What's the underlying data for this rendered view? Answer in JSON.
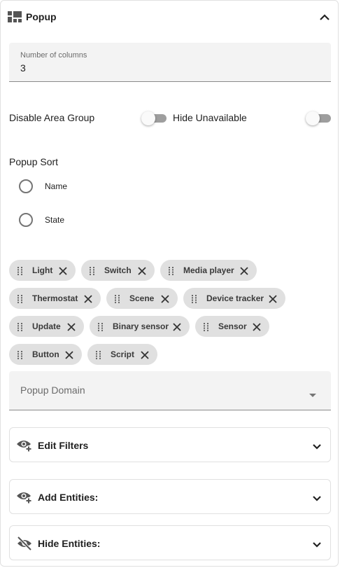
{
  "header": {
    "title": "Popup",
    "icon": "view-dashboard-icon",
    "collapse_icon": "chevron-up-icon"
  },
  "columns_field": {
    "label": "Number of columns",
    "value": "3"
  },
  "toggles": {
    "disable_area_group": {
      "label": "Disable Area Group",
      "on": false
    },
    "hide_unavailable": {
      "label": "Hide Unavailable",
      "on": false
    }
  },
  "popup_sort": {
    "label": "Popup Sort",
    "options": [
      {
        "label": "Name",
        "selected": false
      },
      {
        "label": "State",
        "selected": false
      }
    ]
  },
  "chips": [
    {
      "label": "Light"
    },
    {
      "label": "Switch"
    },
    {
      "label": "Media player"
    },
    {
      "label": "Thermostat"
    },
    {
      "label": "Scene"
    },
    {
      "label": "Device tracker"
    },
    {
      "label": "Update"
    },
    {
      "label": "Binary sensor"
    },
    {
      "label": "Sensor"
    },
    {
      "label": "Button"
    },
    {
      "label": "Script"
    }
  ],
  "popup_domain": {
    "placeholder": "Popup Domain"
  },
  "panels": [
    {
      "title": "Edit Filters",
      "icon": "eye-plus-icon"
    },
    {
      "title": "Add Entities:",
      "icon": "eye-plus-icon"
    },
    {
      "title": "Hide Entities:",
      "icon": "eye-off-icon"
    }
  ],
  "colors": {
    "chip_bg": "#e0e0e0",
    "field_bg": "#f3f3f3",
    "toggle_off": "#9e9e9e"
  }
}
